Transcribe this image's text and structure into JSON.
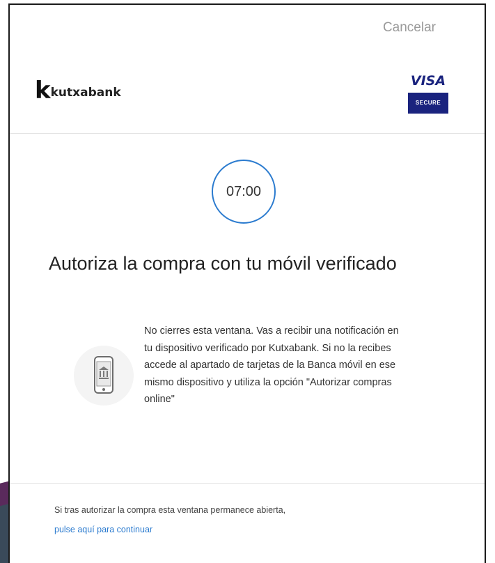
{
  "header": {
    "cancel_label": "Cancelar",
    "bank_logo": {
      "mark": "k",
      "name": "kutxabank"
    },
    "card_brand": {
      "name": "VISA",
      "badge": "SECURE"
    }
  },
  "main": {
    "timer": "07:00",
    "title": "Autoriza la compra con tu móvil verificado",
    "phone_icon": "phone-bank-icon",
    "message": "No cierres esta ventana. Vas a recibir una notificación en tu dispositivo verificado por Kutxabank. Si no la recibes accede al apartado de tarjetas de la Banca móvil en ese mismo dispositivo y utiliza la opción \"Autorizar compras online\""
  },
  "footer": {
    "text": "Si tras autorizar la compra esta ventana permanece abierta,",
    "link": "pulse aquí para continuar"
  },
  "colors": {
    "accent": "#2b7bcf",
    "visa_blue": "#1a237e",
    "muted": "#9a9a9a"
  }
}
